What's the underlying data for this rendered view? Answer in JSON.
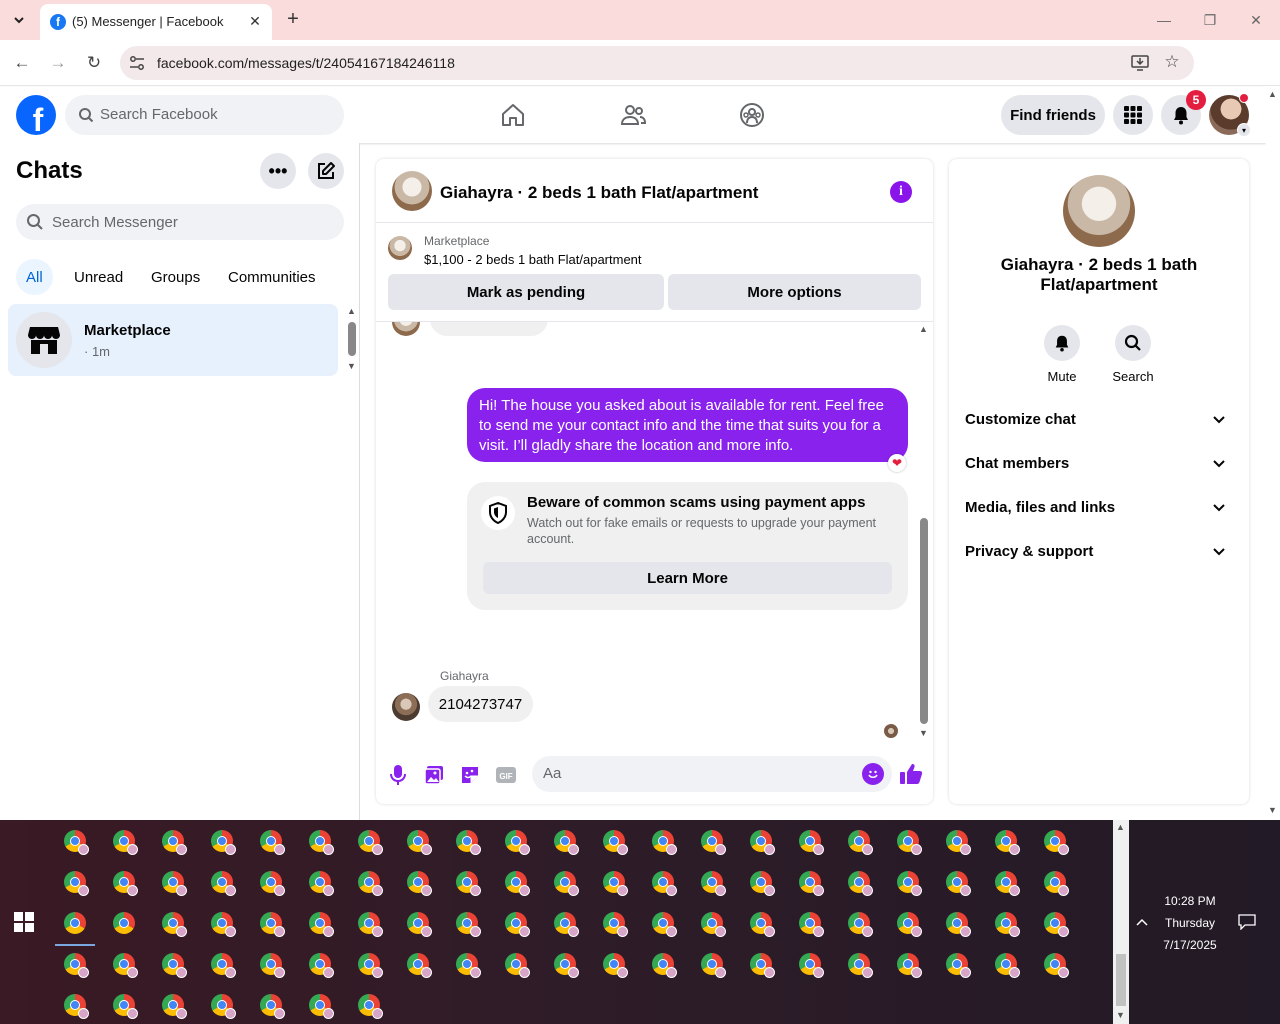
{
  "browser": {
    "tab_title": "(5) Messenger | Facebook",
    "url": "facebook.com/messages/t/24054167184246118",
    "icons": [
      "tab-search-icon",
      "facebook-favicon-icon",
      "close-icon",
      "plus-icon",
      "minimize-icon",
      "restore-icon",
      "window-close-icon",
      "back-icon",
      "forward-icon",
      "reload-icon",
      "site-settings-icon",
      "install-app-icon",
      "star-icon",
      "profile-icon",
      "kebab-menu-icon"
    ]
  },
  "header": {
    "search_placeholder": "Search Facebook",
    "find_friends_label": "Find friends",
    "notifications_count": "5",
    "icons": [
      "facebook-logo-icon",
      "home-icon",
      "friends-icon",
      "groups-icon",
      "menu-grid-icon",
      "bell-icon"
    ]
  },
  "chats": {
    "title": "Chats",
    "search_placeholder": "Search Messenger",
    "filters": [
      "All",
      "Unread",
      "Groups",
      "Communities"
    ],
    "active_filter": "All",
    "items": [
      {
        "name": "Marketplace",
        "time": "· 1m"
      }
    ]
  },
  "conversation": {
    "title": "Giahayra · 2 beds 1 bath Flat/apartment",
    "marketplace": {
      "label": "Marketplace",
      "listing": "$1,100 - 2 beds 1 bath Flat/apartment",
      "pending_label": "Mark as pending",
      "more_label": "More options"
    },
    "outgoing_message": "Hi! The house you asked about is available for rent. Feel free to send me your contact info and the time that suits you for a visit. I’ll gladly share the location and more info.",
    "reaction": "❤",
    "scam_notice": {
      "title": "Beware of common scams using payment apps",
      "body": "Watch out for fake emails or requests to upgrade your payment account.",
      "button_label": "Learn More"
    },
    "incoming": {
      "sender": "Giahayra",
      "message": "2104273747"
    },
    "composer": {
      "placeholder": "Aa",
      "icons": [
        "microphone-icon",
        "photo-icon",
        "sticker-icon",
        "gif-icon",
        "emoji-icon",
        "thumbs-up-icon"
      ]
    },
    "accent_color": "#8a22ee"
  },
  "details": {
    "name": "Giahayra · 2 beds 1 bath Flat/apartment",
    "actions": [
      {
        "label": "Mute",
        "icon": "bell-icon"
      },
      {
        "label": "Search",
        "icon": "search-icon"
      }
    ],
    "sections": [
      "Customize chat",
      "Chat members",
      "Media, files and links",
      "Privacy & support"
    ]
  },
  "taskbar": {
    "time": "10:28 PM",
    "day": "Thursday",
    "date": "7/17/2025"
  }
}
